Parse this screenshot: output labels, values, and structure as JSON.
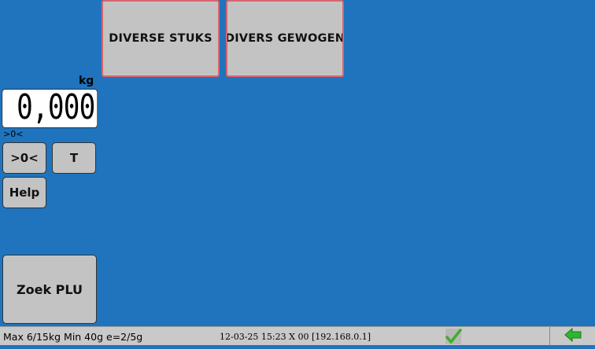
{
  "plu_buttons": [
    {
      "label": "DIVERSE STUKS"
    },
    {
      "label": "DIVERS GEWOGEN"
    }
  ],
  "scale": {
    "unit": "kg",
    "weight": "0,000",
    "zero_indicator": ">0<"
  },
  "keys": {
    "zero": ">0<",
    "tare": "T",
    "help": "Help",
    "search_plu": "Zoek PLU"
  },
  "status_bar": {
    "scale_spec": "Max 6/15kg Min 40g e=2/5g",
    "datetime_info": "12-03-25 15:23 X 00 [192.168.0.1]",
    "status_icon": "check-icon",
    "back_icon": "arrow-left-icon"
  },
  "colors": {
    "background": "#1f74bd",
    "button": "#c3c3c3",
    "plu_border": "#d9646c",
    "check": "#3fae2a",
    "back_arrow": "#2fb52f"
  }
}
